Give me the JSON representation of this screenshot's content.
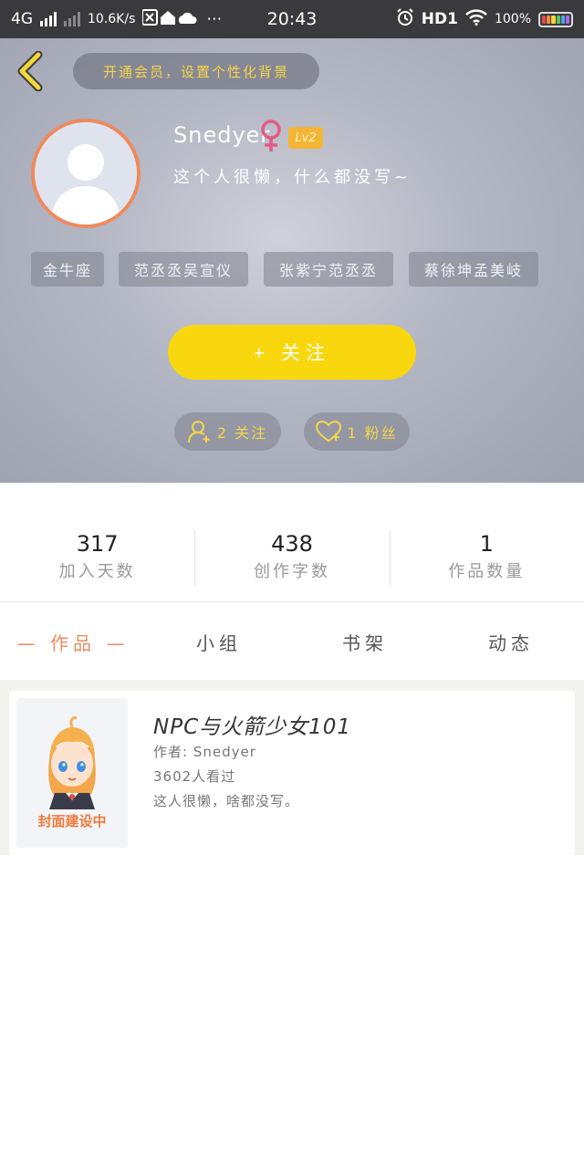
{
  "status_bar": {
    "network": "4G",
    "speed": "10.6K/s",
    "time": "20:43",
    "hd": "HD1",
    "battery": "100%"
  },
  "header": {
    "vip_banner": "开通会员，设置个性化背景",
    "username": "Snedyer",
    "level": "Lv2",
    "bio": "这个人很懒，什么都没写~",
    "tags": [
      "金牛座",
      "范丞丞吴宣仪",
      "张紫宁范丞丞",
      "蔡徐坤孟美岐"
    ],
    "follow_button": "+ 关注",
    "following_label": "2 关注",
    "followers_label": "1 粉丝",
    "colors": {
      "follow": "#f8d70e",
      "accent": "#f4d64a",
      "gender": "#e35b82"
    }
  },
  "stats": [
    {
      "value": "317",
      "label": "加入天数"
    },
    {
      "value": "438",
      "label": "创作字数"
    },
    {
      "value": "1",
      "label": "作品数量"
    }
  ],
  "tabs": [
    {
      "label": "— 作品 —",
      "active": true
    },
    {
      "label": "小组",
      "active": false
    },
    {
      "label": "书架",
      "active": false
    },
    {
      "label": "动态",
      "active": false
    }
  ],
  "works": [
    {
      "title": "NPC与火箭少女101",
      "author": "作者: Snedyer",
      "views": "3602人看过",
      "description": "这人很懒，啥都没写。",
      "cover_text": "封面建设中"
    }
  ]
}
